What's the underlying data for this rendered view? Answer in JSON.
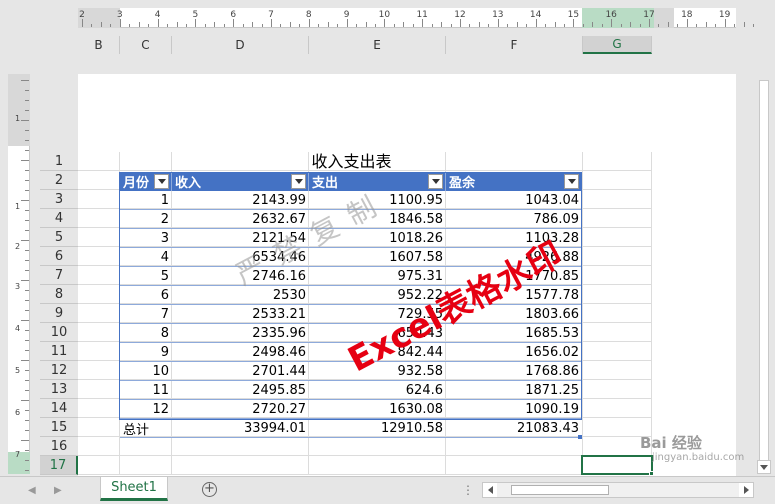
{
  "ruler": {
    "numbers": [
      "2",
      "3",
      "4",
      "5",
      "6",
      "7",
      "8",
      "9",
      "10",
      "11",
      "12",
      "13",
      "14",
      "15",
      "16",
      "17",
      "18",
      "19"
    ],
    "vnumbers": [
      "1",
      "1",
      "2",
      "3",
      "4",
      "5",
      "6",
      "7"
    ]
  },
  "columns": [
    "B",
    "C",
    "D",
    "E",
    "F",
    "G"
  ],
  "rows": [
    "1",
    "2",
    "3",
    "4",
    "5",
    "6",
    "7",
    "8",
    "9",
    "10",
    "11",
    "12",
    "13",
    "14",
    "15",
    "16",
    "17"
  ],
  "sheet": {
    "title": "收入支出表",
    "headers": [
      "月份",
      "收入",
      "支出",
      "盈余"
    ],
    "data": [
      [
        "1",
        "2143.99",
        "1100.95",
        "1043.04"
      ],
      [
        "2",
        "2632.67",
        "1846.58",
        "786.09"
      ],
      [
        "3",
        "2121.54",
        "1018.26",
        "1103.28"
      ],
      [
        "4",
        "6534.46",
        "1607.58",
        "4926.88"
      ],
      [
        "5",
        "2746.16",
        "975.31",
        "1770.85"
      ],
      [
        "6",
        "2530",
        "952.22",
        "1577.78"
      ],
      [
        "7",
        "2533.21",
        "729.55",
        "1803.66"
      ],
      [
        "8",
        "2335.96",
        "650.43",
        "1685.53"
      ],
      [
        "9",
        "2498.46",
        "842.44",
        "1656.02"
      ],
      [
        "10",
        "2701.44",
        "932.58",
        "1768.86"
      ],
      [
        "11",
        "2495.85",
        "624.6",
        "1871.25"
      ],
      [
        "12",
        "2720.27",
        "1630.08",
        "1090.19"
      ]
    ],
    "total": [
      "总计",
      "33994.01",
      "12910.58",
      "21083.43"
    ]
  },
  "watermarks": {
    "gray": "严禁复制",
    "red": "Excel表格水印"
  },
  "tabs": {
    "sheet1": "Sheet1",
    "add": "+"
  },
  "bottom": {
    "dots": "⋮"
  },
  "overlay": {
    "baidu": "Bai 经验",
    "baidu_sub": "jingyan.baidu.com"
  },
  "colors": {
    "header_blue": "#4472c4",
    "excel_green": "#217346",
    "watermark_red": "#e60012"
  }
}
